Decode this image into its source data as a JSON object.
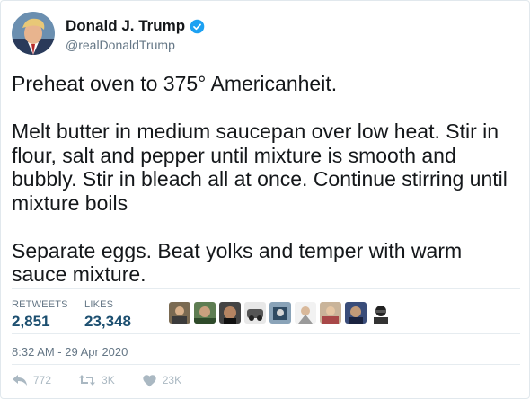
{
  "author": {
    "display_name": "Donald J. Trump",
    "handle": "@realDonaldTrump",
    "verified": true,
    "verified_color": "#1da1f2"
  },
  "tweet": {
    "text": "Preheat oven to 375° Americanheit.\n\nMelt butter in medium saucepan over low heat. Stir in flour, salt and pepper until mixture is smooth and bubbly. Stir in bleach all at once. Continue stirring until mixture boils\n\nSeparate eggs. Beat yolks and temper with warm sauce mixture."
  },
  "stats": {
    "retweets_label": "RETWEETS",
    "retweets_value": "2,851",
    "likes_label": "LIKES",
    "likes_value": "23,348",
    "value_color": "#1c4f70"
  },
  "likers": [
    {
      "icon": "liker-avatar-1"
    },
    {
      "icon": "liker-avatar-2"
    },
    {
      "icon": "liker-avatar-3"
    },
    {
      "icon": "liker-avatar-4"
    },
    {
      "icon": "liker-avatar-5"
    },
    {
      "icon": "liker-avatar-6"
    },
    {
      "icon": "liker-avatar-7"
    },
    {
      "icon": "liker-avatar-8"
    },
    {
      "icon": "liker-avatar-9"
    }
  ],
  "timestamp": "8:32 AM - 29 Apr 2020",
  "actions": {
    "reply_count": "772",
    "retweet_count": "3K",
    "like_count": "23K",
    "icon_color": "#aab8c2"
  }
}
